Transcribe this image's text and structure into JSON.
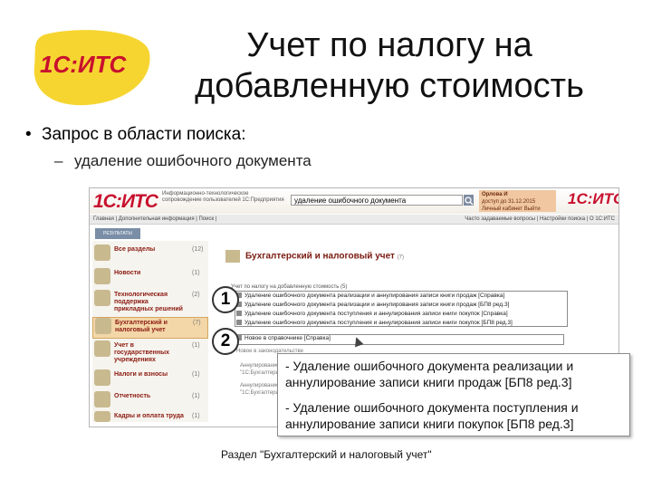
{
  "slide": {
    "logo_text": "1С:ИТС",
    "title_line1": "Учет по налогу на",
    "title_line2": "добавленную стоимость",
    "bullet_main": "Запрос в области поиска:",
    "bullet_sub": "удаление ошибочного документа",
    "bullet_dot": "•",
    "bullet_dash": "–"
  },
  "app": {
    "logo_text": "1С:ИТС",
    "tagline": "Информационно-технологическое сопровождение пользователей 1С:Предприятия",
    "search": {
      "value": "удаление ошибочного документа"
    },
    "user_panel": {
      "name": "Орлова И",
      "line2": "доступ до 31.12.2015",
      "line3": "Личный кабинет   Выйти"
    },
    "nav": {
      "left": "Главная  |  Дополнительная информация  |  Поиск  |",
      "right": "Часто задаваемые вопросы | Настройки поиска | О 1С:ИТС"
    },
    "results_tab": "РЕЗУЛЬТАТЫ ПОИСКА",
    "categories": [
      {
        "label": "Все разделы",
        "count": "(12)"
      },
      {
        "label": "Новости",
        "count": "(1)"
      },
      {
        "label": "Технологическая поддержка прикладных решений",
        "count": "(2)"
      },
      {
        "label": "Бухгалтерский и налоговый учет",
        "count": "(7)"
      },
      {
        "label": "Учет в государственных учреждениях",
        "count": "(1)"
      },
      {
        "label": "Налоги и взносы",
        "count": "(1)"
      },
      {
        "label": "Отчетность",
        "count": "(1)"
      },
      {
        "label": "Кадры и оплата труда",
        "count": "(1)"
      }
    ],
    "main": {
      "heading": "Бухгалтерский и налоговый учет",
      "heading_count": "(7)",
      "subheading": "Учет по налогу на добавленную стоимость (5)",
      "results": [
        "Удаление ошибочного документа реализации и аннулирования записи книги продаж [Справка]",
        "Удаление ошибочного документа реализации и аннулирования записи книги продаж [БП8 ред.3]",
        "Удаление ошибочного документа поступления и аннулирования записи книги покупок [Справка]",
        "Удаление ошибочного документа поступления и аннулирования записи книги покупок [БП8 ред.3]",
        "Новое в справочнике [Справка]"
      ],
      "faint_lines": [
        "Новое в законодательстве",
        "Аннулирование",
        "\"1С:Бухгалтерия\"",
        "Аннулирование",
        "\"1С:Бухгалтерия\""
      ]
    }
  },
  "annotations": {
    "marker1": "1",
    "marker2": "2"
  },
  "callout": {
    "line1": "- Удаление ошибочного документа реализации и аннулирование записи книги продаж [БП8 ред.3]",
    "line2": "- Удаление ошибочного документа поступления и аннулирование записи книги покупок [БП8 ред.3]"
  },
  "caption": "Раздел \"Бухгалтерский и налоговый учет\"",
  "colors": {
    "logo_red": "#c8102e",
    "logo_yellow": "#f6d530",
    "highlight": "#f3d7a8"
  }
}
